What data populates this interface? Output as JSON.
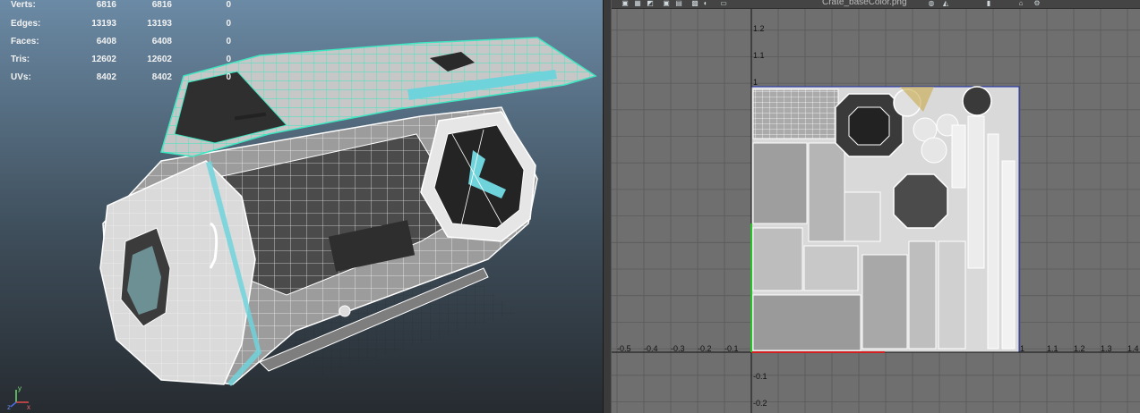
{
  "stats": [
    {
      "label": "Verts:",
      "v1": "6816",
      "v2": "6816",
      "v3": "0"
    },
    {
      "label": "Edges:",
      "v1": "13193",
      "v2": "13193",
      "v3": "0"
    },
    {
      "label": "Faces:",
      "v1": "6408",
      "v2": "6408",
      "v3": "0"
    },
    {
      "label": "Tris:",
      "v1": "12602",
      "v2": "12602",
      "v3": "0"
    },
    {
      "label": "UVs:",
      "v1": "8402",
      "v2": "8402",
      "v3": "0"
    }
  ],
  "axis": {
    "x": "x",
    "y": "y",
    "z": "z"
  },
  "uv_editor": {
    "texture_name": "Crate_baseColor.png",
    "toolbar_icons": [
      "uv-shell-icon",
      "checker-icon",
      "texture-icon",
      "isolate-icon",
      "grid-icon",
      "snap-icon",
      "shaded-icon",
      "image-icon",
      "texture-swatch-icon",
      "display-icon",
      "pin-icon",
      "tool-icon",
      "settings-icon"
    ],
    "x_ticks": [
      "-0.5",
      "-0.4",
      "-0.3",
      "-0.2",
      "-0.1",
      "1",
      "1.1",
      "1.2",
      "1.3",
      "1.4"
    ],
    "y_ticks": [
      "1.2",
      "1.1",
      "1",
      "-0.1",
      "-0.2"
    ]
  },
  "colors": {
    "wire_selected": "#3ee6c1",
    "wire": "#ffffff",
    "accent_cyan": "#6fd3db",
    "uv_grid_bg": "#6f6f6f",
    "uv_border": "#1c2fb0"
  }
}
